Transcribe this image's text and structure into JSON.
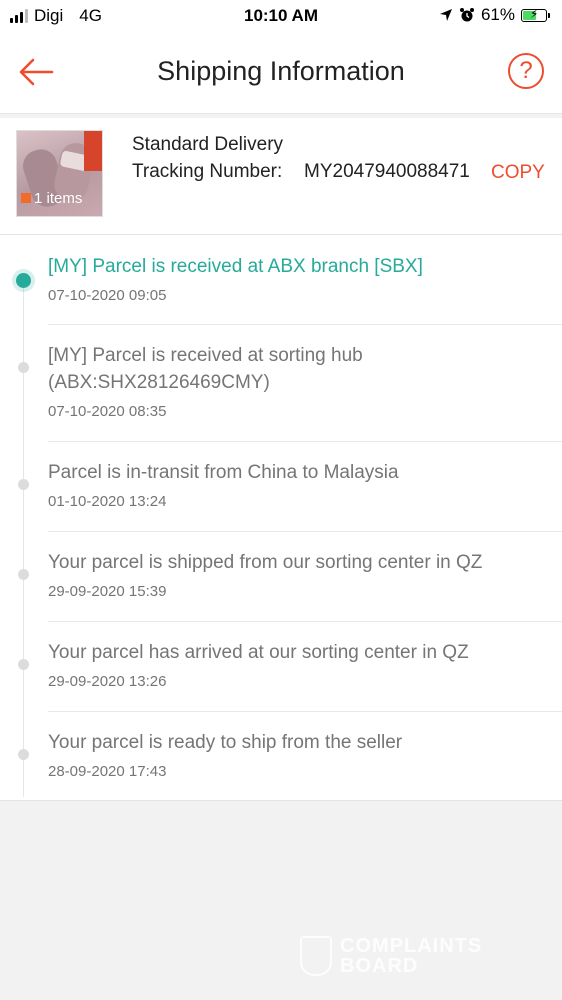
{
  "status_bar": {
    "carrier": "Digi",
    "network": "4G",
    "time": "10:10 AM",
    "battery_percent": "61%",
    "battery_level": 0.61
  },
  "header": {
    "title": "Shipping Information",
    "help_label": "?"
  },
  "summary": {
    "items_badge": "1 items",
    "delivery_type": "Standard Delivery",
    "tracking_label": "Tracking Number:",
    "tracking_number": "MY2047940088471",
    "copy_label": "COPY"
  },
  "events": [
    {
      "message": "[MY] Parcel is received at ABX branch [SBX]",
      "time": "07-10-2020 09:05",
      "current": true
    },
    {
      "message": "[MY] Parcel is received at sorting hub (ABX:SHX28126469CMY)",
      "time": "07-10-2020 08:35",
      "current": false
    },
    {
      "message": "Parcel is in-transit from China to Malaysia",
      "time": "01-10-2020 13:24",
      "current": false
    },
    {
      "message": "Your parcel is shipped from our sorting center in QZ",
      "time": "29-09-2020 15:39",
      "current": false
    },
    {
      "message": "Your parcel has arrived at our sorting center in QZ",
      "time": "29-09-2020 13:26",
      "current": false
    },
    {
      "message": "Your parcel is ready to ship from the seller",
      "time": "28-09-2020 17:43",
      "current": false
    }
  ],
  "watermark": {
    "line1": "COMPLAINTS",
    "line2": "BOARD"
  },
  "colors": {
    "accent": "#ee4d2d",
    "current_status": "#26aa99",
    "muted_text": "#757575",
    "battery": "#4cd964"
  }
}
